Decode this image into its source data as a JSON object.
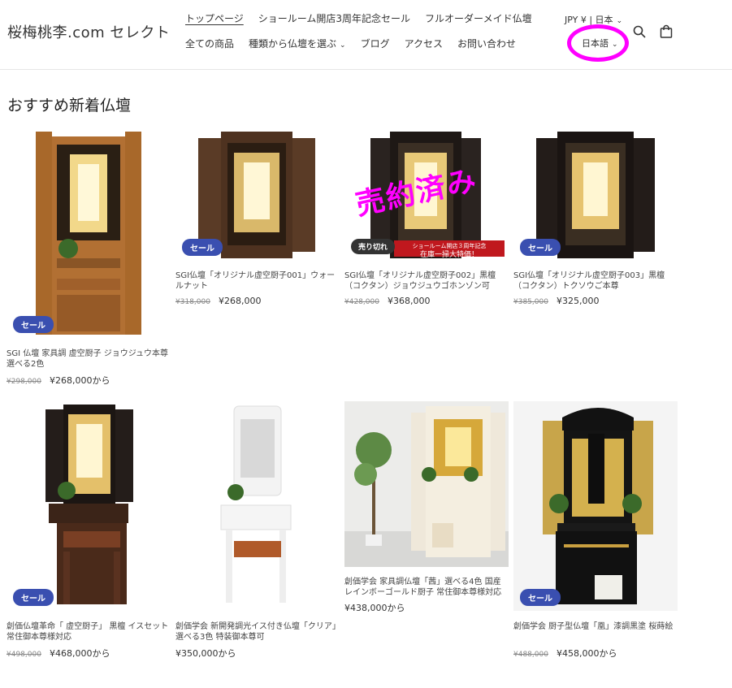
{
  "header": {
    "logo": "桜梅桃李.com セレクト",
    "nav_row1": [
      "トップページ",
      "ショールーム開店3周年記念セール",
      "フルオーダーメイド仏壇"
    ],
    "nav_row2": [
      "全ての商品",
      "種類から仏壇を選ぶ",
      "ブログ",
      "アクセス",
      "お問い合わせ"
    ],
    "locale": "JPY ¥ | 日本",
    "language": "日本語",
    "icons": [
      "search-icon",
      "cart-icon"
    ]
  },
  "section_title": "おすすめ新着仏壇",
  "overlay": {
    "stamp": "売約済み",
    "promo_top": "ショールーム開店３周年記念",
    "promo_main": "在庫一掃大特価！"
  },
  "products": [
    {
      "title": "SGI 仏壇 家具調 虚空厨子 ジョウジュウ本尊選べる2色",
      "old_price": "¥298,000",
      "price": "¥268,000から",
      "badge": "セール"
    },
    {
      "title": "SGI仏壇「オリジナル虚空厨子001」ウォールナット",
      "old_price": "¥318,000",
      "price": "¥268,000",
      "badge": "セール"
    },
    {
      "title": "SGI仏壇「オリジナル虚空厨子002」黒檀（コクタン）ジョウジュウゴホンゾン可",
      "old_price": "¥428,000",
      "price": "¥368,000",
      "badge": "売り切れ"
    },
    {
      "title": "SGI仏壇「オリジナル虚空厨子003」黒檀（コクタン）トクソウご本尊",
      "old_price": "¥385,000",
      "price": "¥325,000",
      "badge": "セール"
    },
    {
      "title": "創価仏壇革命「 虚空厨子」 黒檀 イスセット 常住御本尊様対応",
      "old_price": "¥498,000",
      "price": "¥468,000から",
      "badge": "セール"
    },
    {
      "title": "創価学会 新開発調光イス付き仏壇「クリア」選べる3色 特装御本尊可",
      "old_price": "",
      "price": "¥350,000から",
      "badge": ""
    },
    {
      "title": "創価学会 家具調仏壇「茜」選べる4色 国産レインボーゴールド厨子 常住御本尊様対応",
      "old_price": "",
      "price": "¥438,000から",
      "badge": ""
    },
    {
      "title": "創価学会 厨子型仏壇「凰」漆調黒塗 桜蒔絵",
      "old_price": "¥488,000",
      "price": "¥458,000から",
      "badge": "セール"
    }
  ],
  "colors": {
    "sale_badge": "#3a4fb0",
    "sold_badge": "#333333",
    "highlight": "#ff00ff",
    "promo": "#c0181e"
  }
}
